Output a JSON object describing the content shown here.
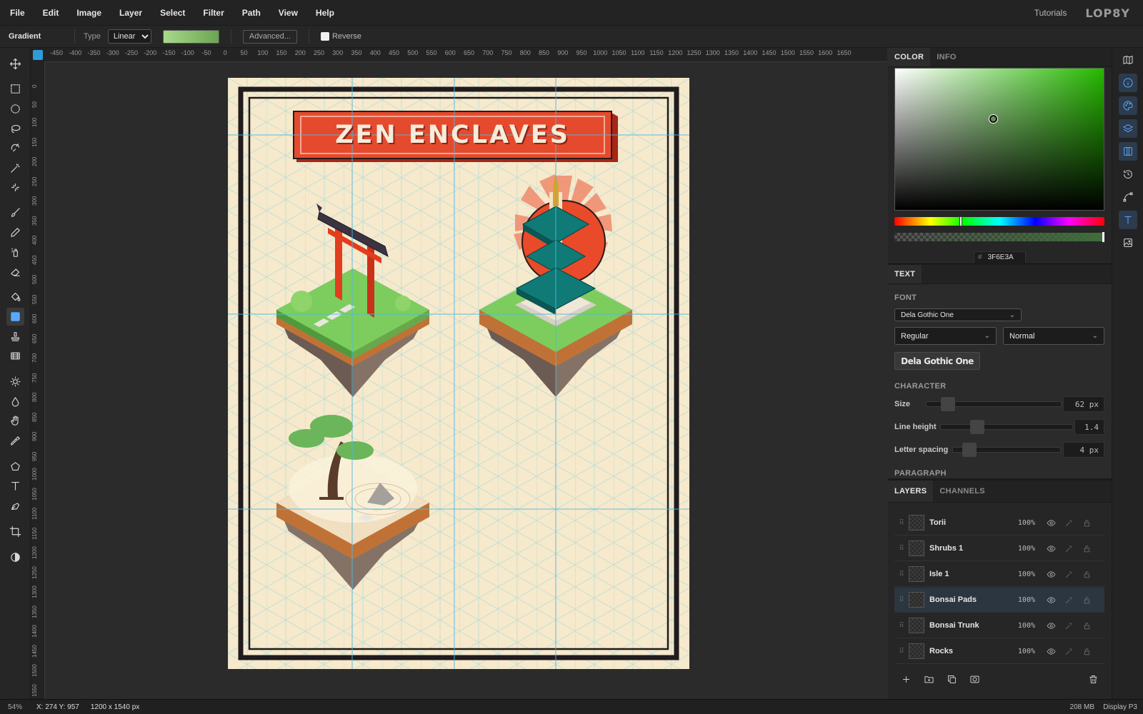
{
  "menu": [
    "File",
    "Edit",
    "Image",
    "Layer",
    "Select",
    "Filter",
    "Path",
    "View",
    "Help"
  ],
  "header": {
    "tutorials": "Tutorials",
    "logo": "LOP8Y"
  },
  "options": {
    "tool": "Gradient",
    "type_label": "Type",
    "type_value": "Linear",
    "advanced": "Advanced...",
    "reverse": "Reverse"
  },
  "ruler_h": [
    "-450",
    "-400",
    "-350",
    "-300",
    "-250",
    "-200",
    "-150",
    "-100",
    "-50",
    "0",
    "50",
    "100",
    "150",
    "200",
    "250",
    "300",
    "350",
    "400",
    "450",
    "500",
    "550",
    "600",
    "650",
    "700",
    "750",
    "800",
    "850",
    "900",
    "950",
    "1000",
    "1050",
    "1100",
    "1150",
    "1200",
    "1250",
    "1300",
    "1350",
    "1400",
    "1450",
    "1500",
    "1550",
    "1600",
    "1650"
  ],
  "ruler_v": [
    "0",
    "50",
    "100",
    "150",
    "200",
    "250",
    "300",
    "350",
    "400",
    "450",
    "500",
    "550",
    "600",
    "650",
    "700",
    "750",
    "800",
    "850",
    "900",
    "950",
    "1000",
    "1050",
    "1100",
    "1150",
    "1200",
    "1250",
    "1300",
    "1350",
    "1400",
    "1450",
    "1500",
    "1550"
  ],
  "poster": {
    "title": "ZEN ENCLAVES"
  },
  "color_panel": {
    "tabs": [
      "COLOR",
      "INFO"
    ],
    "hex_prefix": "#",
    "hex": "3F6E3A"
  },
  "text_panel": {
    "tab": "TEXT",
    "font_label": "FONT",
    "font": "Dela Gothic One",
    "weight": "Regular",
    "style": "Normal",
    "preview": "Dela Gothic One",
    "character_label": "CHARACTER",
    "size_label": "Size",
    "size": "62 px",
    "line_height_label": "Line height",
    "line_height": "1.4",
    "letter_spacing_label": "Letter spacing",
    "letter_spacing": "4 px",
    "paragraph_label": "PARAGRAPH"
  },
  "layers_panel": {
    "tabs": [
      "LAYERS",
      "CHANNELS"
    ],
    "layers": [
      {
        "name": "Torii",
        "opacity": "100%"
      },
      {
        "name": "Shrubs 1",
        "opacity": "100%"
      },
      {
        "name": "Isle 1",
        "opacity": "100%"
      },
      {
        "name": "Bonsai Pads",
        "opacity": "100%"
      },
      {
        "name": "Bonsai Trunk",
        "opacity": "100%"
      },
      {
        "name": "Rocks",
        "opacity": "100%"
      }
    ]
  },
  "status": {
    "zoom": "54%",
    "coords": "X: 274 Y: 957",
    "size": "1200 x 1540 px",
    "memory": "208 MB",
    "display": "Display P3"
  },
  "colors": {
    "accent": "#2d9cdb",
    "poster_bg": "#f6e9cc",
    "title_red": "#e64a2e",
    "teal": "#0f7a76",
    "grass": "#7ccd5e"
  }
}
